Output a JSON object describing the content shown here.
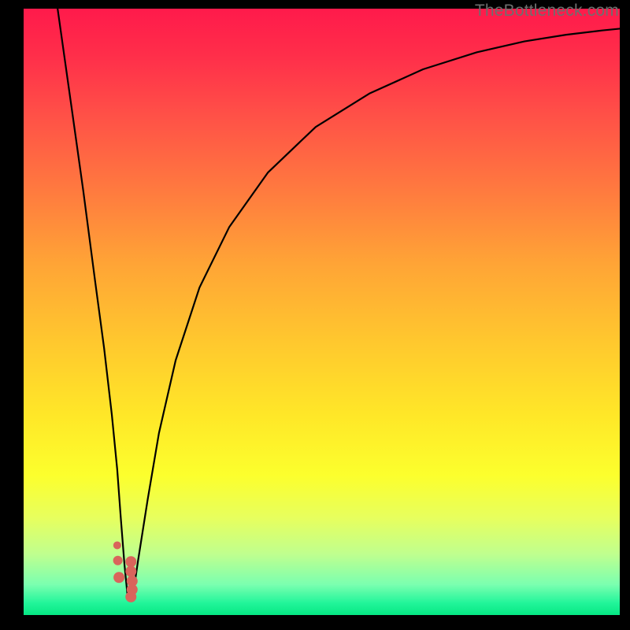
{
  "watermark": "TheBottleneck.com",
  "chart_data": {
    "type": "line",
    "title": "",
    "xlabel": "",
    "ylabel": "",
    "xlim": [
      0,
      100
    ],
    "ylim": [
      0,
      100
    ],
    "grid": false,
    "series": [
      {
        "name": "bottleneck-curve",
        "color": "#000000",
        "x": [
          5.7,
          8.0,
          10.0,
          12.0,
          13.5,
          14.8,
          15.7,
          16.3,
          16.9,
          17.5,
          18.3,
          19.2,
          20.8,
          22.7,
          25.5,
          29.5,
          34.5,
          41.0,
          49.0,
          58.0,
          67.0,
          76.0,
          84.0,
          91.0,
          97.0,
          100.0
        ],
        "y": [
          100.0,
          84.0,
          70.0,
          55.0,
          44.0,
          33.0,
          24.0,
          16.0,
          8.5,
          2.5,
          3.0,
          9.0,
          19.0,
          30.0,
          42.0,
          54.0,
          64.0,
          73.0,
          80.5,
          86.0,
          90.0,
          92.8,
          94.6,
          95.7,
          96.4,
          96.7
        ]
      }
    ],
    "points": {
      "name": "gpu-points",
      "color": "#d9645b",
      "x": [
        15.7,
        15.8,
        16.0,
        18.0,
        18.0,
        18.2,
        18.2,
        18.0
      ],
      "y": [
        11.5,
        9.0,
        6.2,
        8.8,
        7.2,
        5.6,
        4.2,
        3.0
      ],
      "r": [
        5,
        6,
        7,
        7,
        7,
        7,
        7,
        7
      ]
    },
    "background_gradient": {
      "top_color": "#ff1a4b",
      "bottom_color": "#06e783"
    }
  }
}
